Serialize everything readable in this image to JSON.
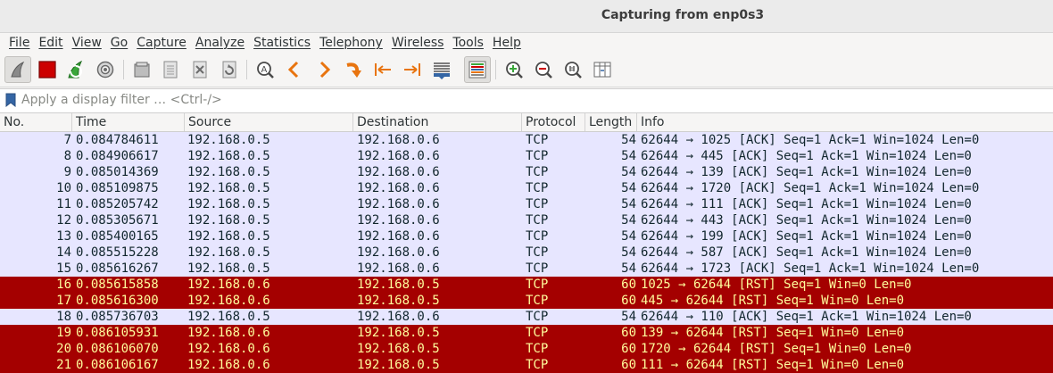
{
  "window": {
    "title": "Capturing from enp0s3"
  },
  "menu": [
    "File",
    "Edit",
    "View",
    "Go",
    "Capture",
    "Analyze",
    "Statistics",
    "Telephony",
    "Wireless",
    "Tools",
    "Help"
  ],
  "toolbar": {
    "icons": [
      "shark-fin-start-icon",
      "stop-capture-icon",
      "restart-capture-icon",
      "capture-options-gear-icon",
      "open-file-icon",
      "save-file-icon",
      "close-file-icon",
      "reload-file-icon",
      "find-packet-icon",
      "go-back-icon",
      "go-forward-icon",
      "go-to-packet-icon",
      "go-first-icon",
      "go-last-icon",
      "auto-scroll-icon",
      "colorize-icon",
      "zoom-in-icon",
      "zoom-out-icon",
      "zoom-normal-icon",
      "resize-columns-icon"
    ],
    "colors": {
      "stop": "#cc0000",
      "arrows": "#e8740f",
      "start": "#6b6b6b"
    }
  },
  "filter": {
    "placeholder": "Apply a display filter … <Ctrl-/>",
    "value": ""
  },
  "packet_list": {
    "columns": [
      "No.",
      "Time",
      "Source",
      "Destination",
      "Protocol",
      "Length",
      "Info"
    ],
    "row_colors": {
      "normal_bg": "#e7e6ff",
      "normal_fg": "#12272e",
      "rst_bg": "#a40000",
      "rst_fg": "#fffc9c"
    },
    "rows": [
      {
        "no": "7",
        "time": "0.084784611",
        "src": "192.168.0.5",
        "dst": "192.168.0.6",
        "proto": "TCP",
        "len": "54",
        "info": "62644 → 1025 [ACK] Seq=1 Ack=1 Win=1024 Len=0",
        "rst": false
      },
      {
        "no": "8",
        "time": "0.084906617",
        "src": "192.168.0.5",
        "dst": "192.168.0.6",
        "proto": "TCP",
        "len": "54",
        "info": "62644 → 445 [ACK] Seq=1 Ack=1 Win=1024 Len=0",
        "rst": false
      },
      {
        "no": "9",
        "time": "0.085014369",
        "src": "192.168.0.5",
        "dst": "192.168.0.6",
        "proto": "TCP",
        "len": "54",
        "info": "62644 → 139 [ACK] Seq=1 Ack=1 Win=1024 Len=0",
        "rst": false
      },
      {
        "no": "10",
        "time": "0.085109875",
        "src": "192.168.0.5",
        "dst": "192.168.0.6",
        "proto": "TCP",
        "len": "54",
        "info": "62644 → 1720 [ACK] Seq=1 Ack=1 Win=1024 Len=0",
        "rst": false
      },
      {
        "no": "11",
        "time": "0.085205742",
        "src": "192.168.0.5",
        "dst": "192.168.0.6",
        "proto": "TCP",
        "len": "54",
        "info": "62644 → 111 [ACK] Seq=1 Ack=1 Win=1024 Len=0",
        "rst": false
      },
      {
        "no": "12",
        "time": "0.085305671",
        "src": "192.168.0.5",
        "dst": "192.168.0.6",
        "proto": "TCP",
        "len": "54",
        "info": "62644 → 443 [ACK] Seq=1 Ack=1 Win=1024 Len=0",
        "rst": false
      },
      {
        "no": "13",
        "time": "0.085400165",
        "src": "192.168.0.5",
        "dst": "192.168.0.6",
        "proto": "TCP",
        "len": "54",
        "info": "62644 → 199 [ACK] Seq=1 Ack=1 Win=1024 Len=0",
        "rst": false
      },
      {
        "no": "14",
        "time": "0.085515228",
        "src": "192.168.0.5",
        "dst": "192.168.0.6",
        "proto": "TCP",
        "len": "54",
        "info": "62644 → 587 [ACK] Seq=1 Ack=1 Win=1024 Len=0",
        "rst": false
      },
      {
        "no": "15",
        "time": "0.085616267",
        "src": "192.168.0.5",
        "dst": "192.168.0.6",
        "proto": "TCP",
        "len": "54",
        "info": "62644 → 1723 [ACK] Seq=1 Ack=1 Win=1024 Len=0",
        "rst": false
      },
      {
        "no": "16",
        "time": "0.085615858",
        "src": "192.168.0.6",
        "dst": "192.168.0.5",
        "proto": "TCP",
        "len": "60",
        "info": "1025 → 62644 [RST] Seq=1 Win=0 Len=0",
        "rst": true
      },
      {
        "no": "17",
        "time": "0.085616300",
        "src": "192.168.0.6",
        "dst": "192.168.0.5",
        "proto": "TCP",
        "len": "60",
        "info": "445 → 62644 [RST] Seq=1 Win=0 Len=0",
        "rst": true
      },
      {
        "no": "18",
        "time": "0.085736703",
        "src": "192.168.0.5",
        "dst": "192.168.0.6",
        "proto": "TCP",
        "len": "54",
        "info": "62644 → 110 [ACK] Seq=1 Ack=1 Win=1024 Len=0",
        "rst": false
      },
      {
        "no": "19",
        "time": "0.086105931",
        "src": "192.168.0.6",
        "dst": "192.168.0.5",
        "proto": "TCP",
        "len": "60",
        "info": "139 → 62644 [RST] Seq=1 Win=0 Len=0",
        "rst": true
      },
      {
        "no": "20",
        "time": "0.086106070",
        "src": "192.168.0.6",
        "dst": "192.168.0.5",
        "proto": "TCP",
        "len": "60",
        "info": "1720 → 62644 [RST] Seq=1 Win=0 Len=0",
        "rst": true
      },
      {
        "no": "21",
        "time": "0.086106167",
        "src": "192.168.0.6",
        "dst": "192.168.0.5",
        "proto": "TCP",
        "len": "60",
        "info": "111 → 62644 [RST] Seq=1 Win=0 Len=0",
        "rst": true
      }
    ]
  }
}
